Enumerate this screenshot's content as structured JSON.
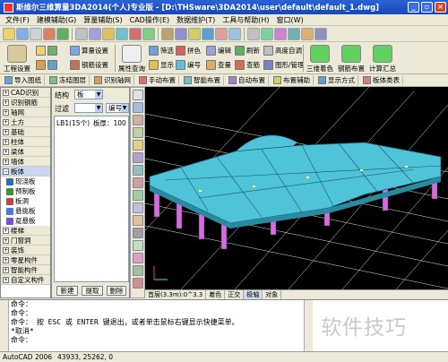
{
  "window": {
    "title": "斯维尔三维算量3DA2014(个人)专业版 - [D:\\THSware\\3DA2014\\user\\default\\default_1.dwg]",
    "controls": [
      "minimize",
      "restore",
      "close"
    ]
  },
  "menubar": [
    "文件(F)",
    "建模辅助(G)",
    "算量辅助(S)",
    "CAD操作(E)",
    "数据维护(T)",
    "工具与帮助(H)",
    "窗口(W)"
  ],
  "ribbon": {
    "project_settings": "工程设置",
    "count_settings": "算量设置",
    "rebar_settings": "钢筋设置",
    "attribute_query": "属性查询",
    "filter": "筛选",
    "show": "显示",
    "color": "拼色",
    "number": "编号",
    "edit": "编辑",
    "lookup": "查量",
    "refresh": "刷新",
    "check_quantity": "查筋",
    "height_auto": "高度自调",
    "drawing_mgmt": "图形/管理",
    "three_dim_color": "三维着色",
    "rebar_layout": "钢筋布置",
    "calc_summary": "计算汇总"
  },
  "command_bar": [
    "导入图纸",
    "冻结图层",
    "识别轴网",
    "手动布置",
    "智能布置",
    "自动布置",
    "布置辅助",
    "显示方式",
    "板体类表"
  ],
  "left_tree": [
    {
      "label": "CAD识别",
      "type": "cat",
      "expanded": false
    },
    {
      "label": "识别钢筋",
      "type": "cat",
      "expanded": false
    },
    {
      "label": "轴网",
      "type": "cat",
      "expanded": false
    },
    {
      "label": "土方",
      "type": "cat",
      "expanded": false
    },
    {
      "label": "基础",
      "type": "cat",
      "expanded": false
    },
    {
      "label": "柱体",
      "type": "cat",
      "expanded": false
    },
    {
      "label": "梁体",
      "type": "cat",
      "expanded": false
    },
    {
      "label": "墙体",
      "type": "cat",
      "expanded": false
    },
    {
      "label": "板体",
      "type": "cat",
      "expanded": true
    },
    {
      "label": "现浇板",
      "type": "sub",
      "icon": "slab-icon",
      "color": "#2c6fb8"
    },
    {
      "label": "预制板",
      "type": "sub",
      "icon": "precast-slab-icon",
      "color": "#4a8a3a"
    },
    {
      "label": "板洞",
      "type": "sub",
      "icon": "slab-hole-icon",
      "color": "#b84848"
    },
    {
      "label": "悬挑板",
      "type": "sub",
      "icon": "cantilever-slab-icon",
      "color": "#4a7ad8"
    },
    {
      "label": "趸悬板",
      "type": "sub",
      "icon": "hanging-slab-icon",
      "color": "#7a4ad8"
    },
    {
      "label": "楼梯",
      "type": "cat",
      "expanded": false
    },
    {
      "label": "门窗洞",
      "type": "cat",
      "expanded": false
    },
    {
      "label": "装饰",
      "type": "cat",
      "expanded": false
    },
    {
      "label": "零星构件",
      "type": "cat",
      "expanded": false
    },
    {
      "label": "智能构件",
      "type": "cat",
      "expanded": false
    },
    {
      "label": "自定义构件",
      "type": "cat",
      "expanded": false
    }
  ],
  "mid_panel": {
    "structure_label": "结构",
    "structure_value": "板",
    "filter_label": "过滤",
    "number_label": "编号",
    "item_label": "LB1(15个)",
    "thickness_label": "板厚：100",
    "buttons": [
      "新建",
      "提取",
      "删除"
    ]
  },
  "status_strip": {
    "floor": "首层(3.3m):0^3.3",
    "toggles": [
      "着色",
      "正交",
      "极轴",
      "对象"
    ],
    "active_toggle": "极轴"
  },
  "command_window": {
    "lines": [
      "命令：",
      "命令：",
      "命令： 按 ESC 或 ENTER 键退出，或者单击鼠标右键显示快捷菜单。",
      "*取消*",
      "命令："
    ]
  },
  "watermark": "软件技巧",
  "app_status": {
    "app": "AutoCAD 2006",
    "coords": "43933, 25262, 0"
  },
  "colors": {
    "slab": "#4fc3d8",
    "column": "#d070d8",
    "grid": "#ffffff",
    "viewport_bg": "#000000",
    "titlebar": "#1f55c8"
  }
}
